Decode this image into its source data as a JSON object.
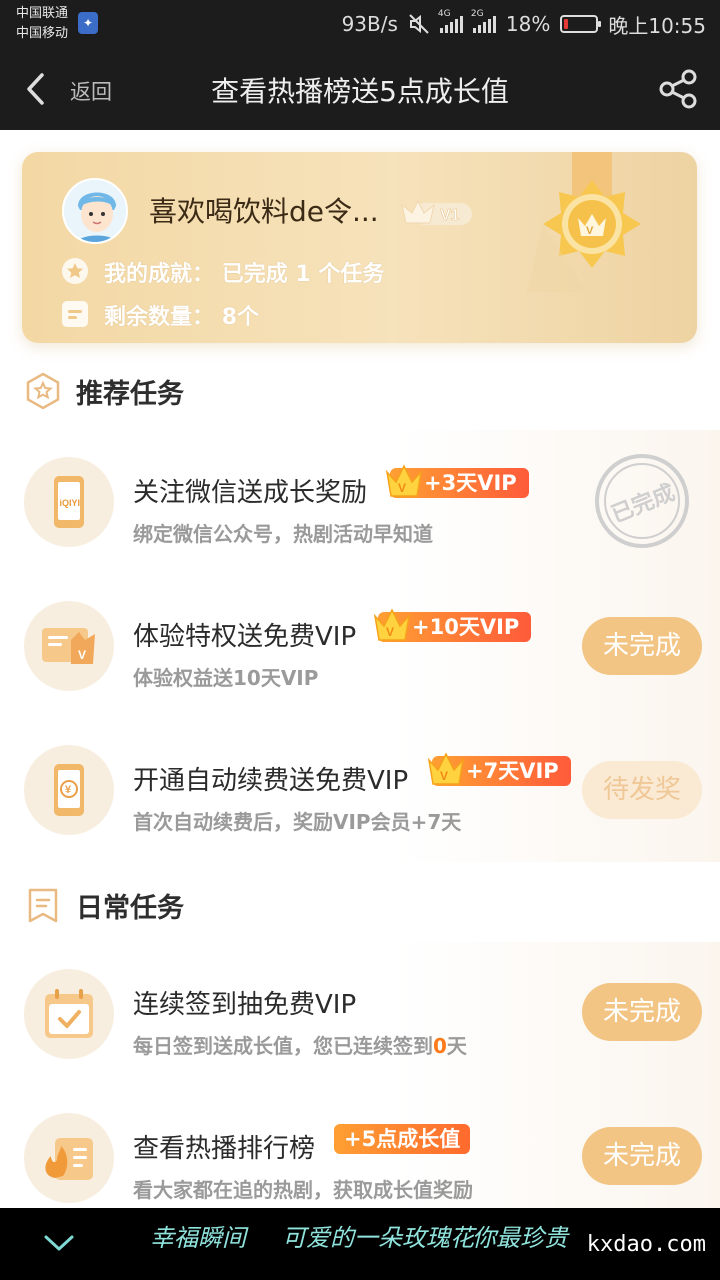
{
  "status_bar": {
    "carrier_1": "中国联通",
    "carrier_2": "中国移动",
    "network_speed": "93B/s",
    "signal_1_tag": "4G",
    "signal_2_tag": "2G",
    "battery": "18%",
    "time": "晚上10:55"
  },
  "nav": {
    "back_label": "返回",
    "title": "查看热播榜送5点成长值"
  },
  "profile": {
    "username": "喜欢喝饮料de令...",
    "level": "V1",
    "achievement_label": "我的成就：",
    "achievement_value": "已完成",
    "achievement_count": "1",
    "achievement_suffix": "个任务",
    "remaining_label": "剩余数量：",
    "remaining_value": "8个"
  },
  "sections": {
    "recommended": "推荐任务",
    "daily": "日常任务"
  },
  "tasks": [
    {
      "title": "关注微信送成长奖励",
      "tag": "+3天VIP",
      "subtitle": "绑定微信公众号，热剧活动早知道",
      "status": "已完成"
    },
    {
      "title": "体验特权送免费VIP",
      "tag": "+10天VIP",
      "subtitle": "体验权益送10天VIP",
      "status": "未完成"
    },
    {
      "title": "开通自动续费送免费VIP",
      "tag": "+7天VIP",
      "subtitle": "首次自动续费后，奖励VIP会员+7天",
      "status": "待发奖"
    },
    {
      "title": "连续签到抽免费VIP",
      "tag": "",
      "subtitle_a": "每日签到送成长值，您已连续签到",
      "subtitle_days": "0",
      "subtitle_b": "天",
      "status": "未完成"
    },
    {
      "title": "查看热播排行榜",
      "tag": "+5点成长值",
      "subtitle": "看大家都在追的热剧，获取成长值奖励",
      "status": "未完成"
    }
  ],
  "bottom_bar": {
    "deco_1": "幸福瞬间",
    "deco_2": "可爱的一朵玫瑰花",
    "deco_3": "你最珍贵",
    "site": "kxdao.com"
  },
  "colors": {
    "accent_orange": "#ff7a1a",
    "button_gold": "#f2c585",
    "card_gold": "#f3d8a4"
  }
}
